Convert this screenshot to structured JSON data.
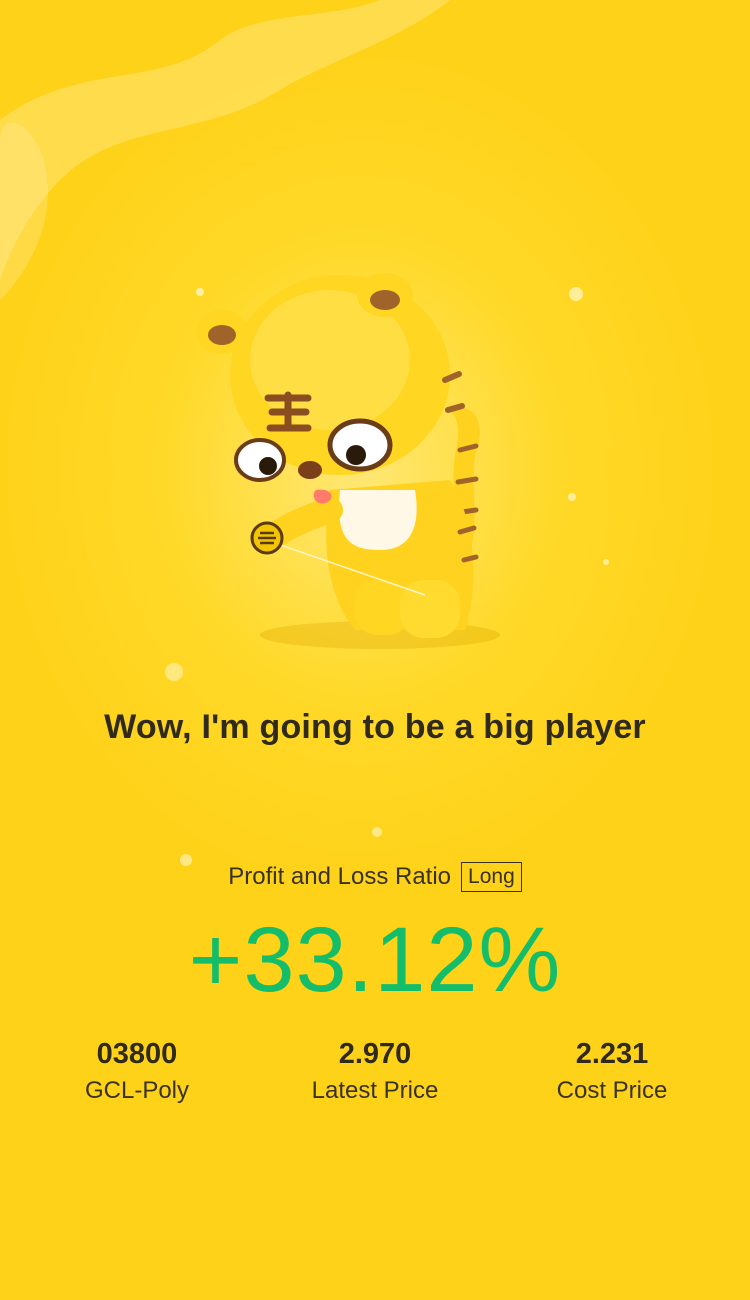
{
  "headline": "Wow, I'm going to be a big player",
  "ratio": {
    "label": "Profit and Loss Ratio",
    "badge": "Long",
    "value": "+33.12%"
  },
  "stats": [
    {
      "value": "03800",
      "label": "GCL-Poly"
    },
    {
      "value": "2.970",
      "label": "Latest Price"
    },
    {
      "value": "2.231",
      "label": "Cost Price"
    }
  ],
  "colors": {
    "background": "#ffd21a",
    "profit_green": "#14bd6a",
    "text_dark": "#2f2a1a"
  },
  "mascot": {
    "icon": "tiger-mascot-icon"
  }
}
